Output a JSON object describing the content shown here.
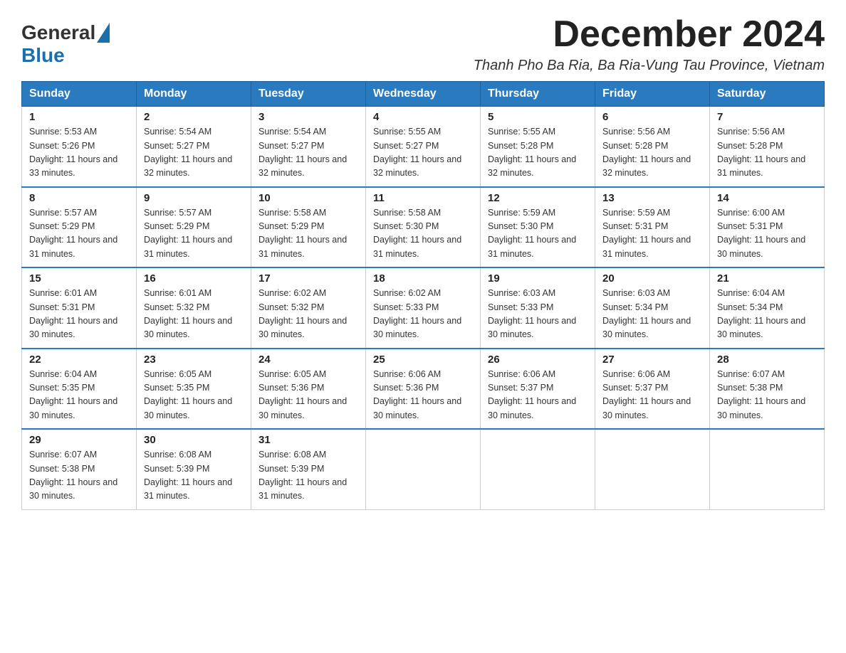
{
  "logo": {
    "general": "General",
    "blue": "Blue"
  },
  "title": "December 2024",
  "location": "Thanh Pho Ba Ria, Ba Ria-Vung Tau Province, Vietnam",
  "weekdays": [
    "Sunday",
    "Monday",
    "Tuesday",
    "Wednesday",
    "Thursday",
    "Friday",
    "Saturday"
  ],
  "weeks": [
    [
      {
        "day": "1",
        "sunrise": "5:53 AM",
        "sunset": "5:26 PM",
        "daylight": "11 hours and 33 minutes."
      },
      {
        "day": "2",
        "sunrise": "5:54 AM",
        "sunset": "5:27 PM",
        "daylight": "11 hours and 32 minutes."
      },
      {
        "day": "3",
        "sunrise": "5:54 AM",
        "sunset": "5:27 PM",
        "daylight": "11 hours and 32 minutes."
      },
      {
        "day": "4",
        "sunrise": "5:55 AM",
        "sunset": "5:27 PM",
        "daylight": "11 hours and 32 minutes."
      },
      {
        "day": "5",
        "sunrise": "5:55 AM",
        "sunset": "5:28 PM",
        "daylight": "11 hours and 32 minutes."
      },
      {
        "day": "6",
        "sunrise": "5:56 AM",
        "sunset": "5:28 PM",
        "daylight": "11 hours and 32 minutes."
      },
      {
        "day": "7",
        "sunrise": "5:56 AM",
        "sunset": "5:28 PM",
        "daylight": "11 hours and 31 minutes."
      }
    ],
    [
      {
        "day": "8",
        "sunrise": "5:57 AM",
        "sunset": "5:29 PM",
        "daylight": "11 hours and 31 minutes."
      },
      {
        "day": "9",
        "sunrise": "5:57 AM",
        "sunset": "5:29 PM",
        "daylight": "11 hours and 31 minutes."
      },
      {
        "day": "10",
        "sunrise": "5:58 AM",
        "sunset": "5:29 PM",
        "daylight": "11 hours and 31 minutes."
      },
      {
        "day": "11",
        "sunrise": "5:58 AM",
        "sunset": "5:30 PM",
        "daylight": "11 hours and 31 minutes."
      },
      {
        "day": "12",
        "sunrise": "5:59 AM",
        "sunset": "5:30 PM",
        "daylight": "11 hours and 31 minutes."
      },
      {
        "day": "13",
        "sunrise": "5:59 AM",
        "sunset": "5:31 PM",
        "daylight": "11 hours and 31 minutes."
      },
      {
        "day": "14",
        "sunrise": "6:00 AM",
        "sunset": "5:31 PM",
        "daylight": "11 hours and 30 minutes."
      }
    ],
    [
      {
        "day": "15",
        "sunrise": "6:01 AM",
        "sunset": "5:31 PM",
        "daylight": "11 hours and 30 minutes."
      },
      {
        "day": "16",
        "sunrise": "6:01 AM",
        "sunset": "5:32 PM",
        "daylight": "11 hours and 30 minutes."
      },
      {
        "day": "17",
        "sunrise": "6:02 AM",
        "sunset": "5:32 PM",
        "daylight": "11 hours and 30 minutes."
      },
      {
        "day": "18",
        "sunrise": "6:02 AM",
        "sunset": "5:33 PM",
        "daylight": "11 hours and 30 minutes."
      },
      {
        "day": "19",
        "sunrise": "6:03 AM",
        "sunset": "5:33 PM",
        "daylight": "11 hours and 30 minutes."
      },
      {
        "day": "20",
        "sunrise": "6:03 AM",
        "sunset": "5:34 PM",
        "daylight": "11 hours and 30 minutes."
      },
      {
        "day": "21",
        "sunrise": "6:04 AM",
        "sunset": "5:34 PM",
        "daylight": "11 hours and 30 minutes."
      }
    ],
    [
      {
        "day": "22",
        "sunrise": "6:04 AM",
        "sunset": "5:35 PM",
        "daylight": "11 hours and 30 minutes."
      },
      {
        "day": "23",
        "sunrise": "6:05 AM",
        "sunset": "5:35 PM",
        "daylight": "11 hours and 30 minutes."
      },
      {
        "day": "24",
        "sunrise": "6:05 AM",
        "sunset": "5:36 PM",
        "daylight": "11 hours and 30 minutes."
      },
      {
        "day": "25",
        "sunrise": "6:06 AM",
        "sunset": "5:36 PM",
        "daylight": "11 hours and 30 minutes."
      },
      {
        "day": "26",
        "sunrise": "6:06 AM",
        "sunset": "5:37 PM",
        "daylight": "11 hours and 30 minutes."
      },
      {
        "day": "27",
        "sunrise": "6:06 AM",
        "sunset": "5:37 PM",
        "daylight": "11 hours and 30 minutes."
      },
      {
        "day": "28",
        "sunrise": "6:07 AM",
        "sunset": "5:38 PM",
        "daylight": "11 hours and 30 minutes."
      }
    ],
    [
      {
        "day": "29",
        "sunrise": "6:07 AM",
        "sunset": "5:38 PM",
        "daylight": "11 hours and 30 minutes."
      },
      {
        "day": "30",
        "sunrise": "6:08 AM",
        "sunset": "5:39 PM",
        "daylight": "11 hours and 31 minutes."
      },
      {
        "day": "31",
        "sunrise": "6:08 AM",
        "sunset": "5:39 PM",
        "daylight": "11 hours and 31 minutes."
      },
      null,
      null,
      null,
      null
    ]
  ]
}
